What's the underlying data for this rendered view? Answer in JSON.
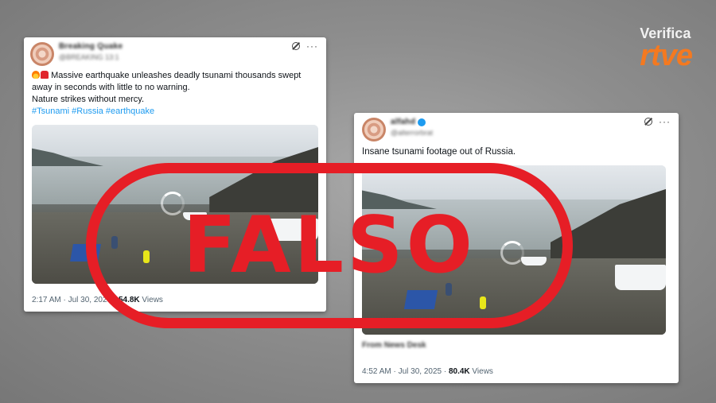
{
  "logo": {
    "verifica": "Verifica",
    "rtve": "rtve"
  },
  "stamp": {
    "label": "FALSO",
    "color": "#e61e26"
  },
  "tweet1": {
    "name": "Breaking Quake",
    "handle": "@BREAKING 13:1",
    "text_line1": "Massive earthquake unleashes deadly tsunami thousands swept",
    "text_line2": "away in seconds with little to no warning.",
    "text_line3": "Nature strikes without mercy.",
    "hashtags": "#Tsunami #Russia #earthquake",
    "timestamp": "2:17 AM · Jul 30, 2025 · ",
    "views_count": "54.8K",
    "views_label": " Views"
  },
  "tweet2": {
    "name": "alfahd",
    "handle": "@alterrorbrat",
    "text": "Insane tsunami footage out of Russia.",
    "footer_blur": "From News Desk",
    "timestamp": "4:52 AM · Jul 30, 2025 · ",
    "views_count": "80.4K",
    "views_label": " Views"
  },
  "colors": {
    "hashtag": "#1d9bf0",
    "rtve_orange": "#f47920"
  },
  "icons": {
    "grok": "grok-icon",
    "more": "more-icon",
    "loading": "loading-spinner-icon",
    "verified": "verified-badge-icon"
  }
}
